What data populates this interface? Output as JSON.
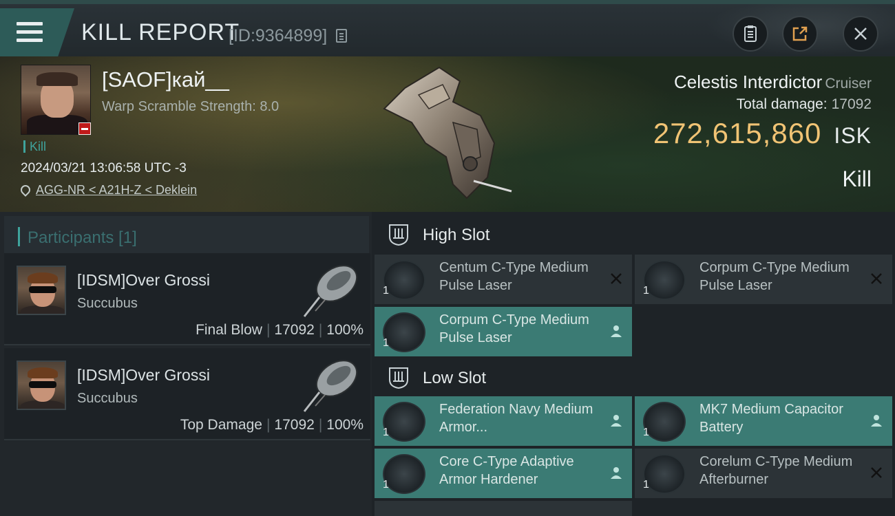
{
  "header": {
    "title": "KILL REPORT",
    "report_id": "[ID:9364899]"
  },
  "victim": {
    "name": "[SAOF]кай__",
    "warp_scramble": "Warp Scramble Strength: 8.0",
    "kill_tag": "Kill",
    "time": "2024/03/21 13:06:58 UTC -3",
    "location": "AGG-NR < A21H-Z < Deklein",
    "ship_name": "Celestis Interdictor",
    "ship_class": "Cruiser",
    "total_damage_label": "Total damage:",
    "total_damage": "17092",
    "isk_value": "272,615,860",
    "isk_unit": "ISK",
    "result": "Kill"
  },
  "participants": {
    "header": "Participants [1]",
    "items": [
      {
        "name": "[IDSM]Over Grossi",
        "ship": "Succubus",
        "role": "Final Blow",
        "damage": "17092",
        "percent": "100%"
      },
      {
        "name": "[IDSM]Over Grossi",
        "ship": "Succubus",
        "role": "Top Damage",
        "damage": "17092",
        "percent": "100%"
      }
    ],
    "separator": "|"
  },
  "fitting": {
    "high_slot": {
      "title": "High Slot",
      "modules": [
        {
          "qty": "1",
          "name": "Centum C-Type Medium Pulse Laser",
          "icon": "pulse-laser-icon",
          "state": "destroyed"
        },
        {
          "qty": "1",
          "name": "Corpum C-Type Medium Pulse Laser",
          "icon": "pulse-laser-icon",
          "state": "destroyed"
        },
        {
          "qty": "1",
          "name": "Corpum C-Type Medium Pulse Laser",
          "icon": "pulse-laser-icon",
          "state": "dropped"
        }
      ]
    },
    "low_slot": {
      "title": "Low Slot",
      "modules": [
        {
          "qty": "1",
          "name": "Federation Navy Medium Armor...",
          "icon": "armor-repairer-icon",
          "state": "dropped"
        },
        {
          "qty": "1",
          "name": "MK7 Medium Capacitor Battery",
          "icon": "capacitor-battery-icon",
          "state": "dropped"
        },
        {
          "qty": "1",
          "name": "Core C-Type Adaptive Armor Hardener",
          "icon": "armor-hardener-icon",
          "state": "dropped"
        },
        {
          "qty": "1",
          "name": "Corelum C-Type Medium Afterburner",
          "icon": "afterburner-icon",
          "state": "destroyed"
        }
      ]
    }
  },
  "colors": {
    "accent": "#3fa39c",
    "isk": "#f0c374",
    "dropped_row": "#3b7b74",
    "destroyed_row": "#2c3337"
  }
}
